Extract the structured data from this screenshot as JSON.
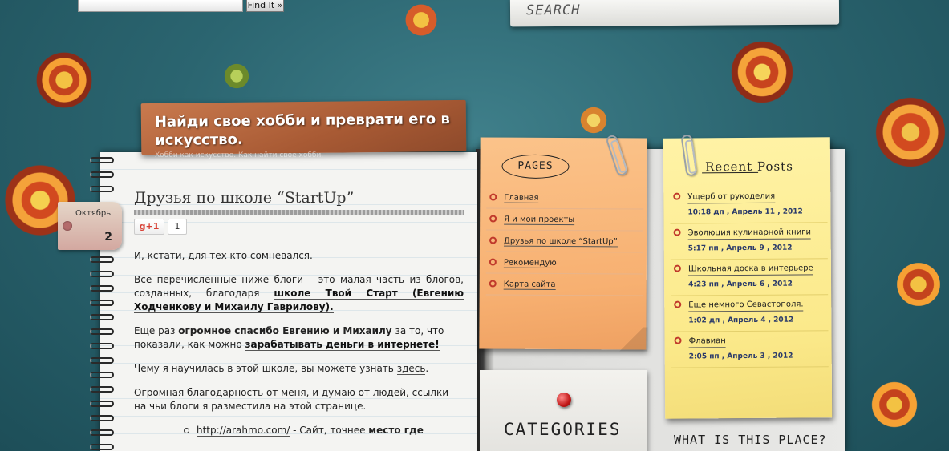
{
  "header": {
    "find_button": "Find It »",
    "search_label": "SEARCH",
    "site_title": "Найди свое хобби и преврати его в искусство.",
    "site_tagline": "Хобби как искусство. Как найти свое хобби."
  },
  "date_tag": {
    "month": "Октябрь",
    "day": "2"
  },
  "post": {
    "title": "Друзья по школе “StartUp”",
    "gplus_label": "+1",
    "gplus_count": "1",
    "p1": "И, кстати, для тех кто сомневался.",
    "p2_text": "Все перечисленные ниже блоги – это малая часть из блогов, созданных, благодаря ",
    "p2_link": "школе Твой Старт (Евгению Ходченкову и Михаилу Гаврилову).",
    "p3_a": "Еще раз ",
    "p3_bold": "огромное спасибо Евгению и Михаилу",
    "p3_b": " за то, что показали, как можно ",
    "p3_link": "зарабатывать деньги в интернете!",
    "p4_text": "Чему я научилась в этой школе, вы можете узнать ",
    "p4_link": "здесь",
    "p4_end": ".",
    "p5": "Огромная благодарность от меня, и думаю от людей, ссылки на чьи блоги я разместила на этой странице.",
    "li1_link": "http://arahmo.com/",
    "li1_text": " - Сайт, точнее ",
    "li1_bold": "место где"
  },
  "sidebar": {
    "pages_label": "PAGES",
    "pages": [
      "Главная",
      "Я и мои проекты",
      "Друзья по школе “StartUp”",
      "Рекомендую",
      "Карта сайта"
    ],
    "categories_label": "CATEGORIES",
    "recent_label": "Recent Posts",
    "recent": [
      {
        "title": "Ущерб от рукоделия",
        "date": "10:18 дп , Апрель 11 , 2012"
      },
      {
        "title": "Эволюция кулинарной книги",
        "date": "5:17 пп , Апрель 9 , 2012"
      },
      {
        "title": "Школьная доска в интерьере",
        "date": "4:23 пп , Апрель 6 , 2012"
      },
      {
        "title": "Еще немного Севастополя.",
        "date": "1:02 дп , Апрель 4 , 2012"
      },
      {
        "title": "Флавиан",
        "date": "2:05 пп , Апрель 3 , 2012"
      }
    ],
    "what_label": "WHAT IS THIS PLACE?"
  },
  "colors": {
    "background": "#2b6570",
    "banner": "#a85a34",
    "note_orange": "#f7b071",
    "note_yellow": "#fbe98a",
    "bullet": "#c0392b"
  }
}
